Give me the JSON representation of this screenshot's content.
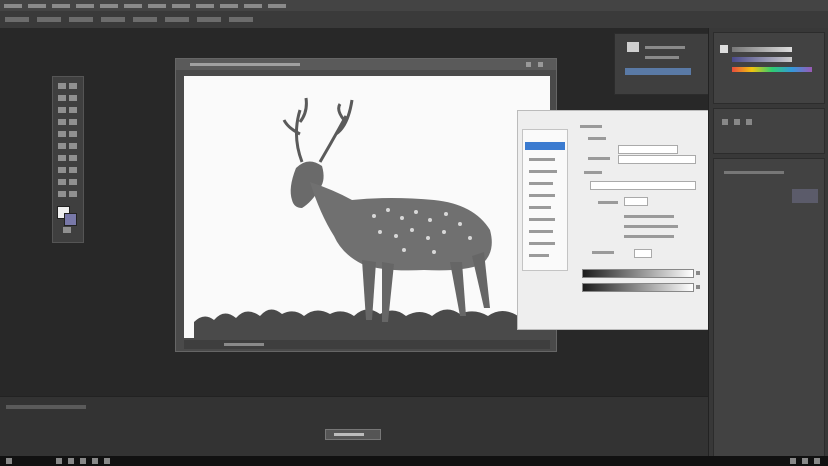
{
  "app": {
    "title": ""
  },
  "menubar": {
    "item_count": 14
  },
  "options_bar": {
    "chip_count": 10
  },
  "toolbox": {
    "tool_count": 24,
    "colors": {
      "foreground": "#f0f0f0",
      "background": "#7878a8"
    }
  },
  "document": {
    "canvas_background": "#fafafa",
    "subject_icon": "deer-image",
    "tab_title": "",
    "status_text": ""
  },
  "dialog": {
    "title": "",
    "buttons": [
      {
        "name": "ok-button",
        "label": ""
      },
      {
        "name": "cancel-button",
        "label": ""
      },
      {
        "name": "preview-button",
        "label": ""
      }
    ],
    "accent": "#4a8bd6",
    "swatch_color": "#d86a6a"
  },
  "panels": {
    "color_swatches": [
      "#e84c3d",
      "#f1c40f",
      "#2ecc71",
      "#3498db",
      "#9b59b6"
    ]
  },
  "timeline": {
    "button_label": ""
  }
}
